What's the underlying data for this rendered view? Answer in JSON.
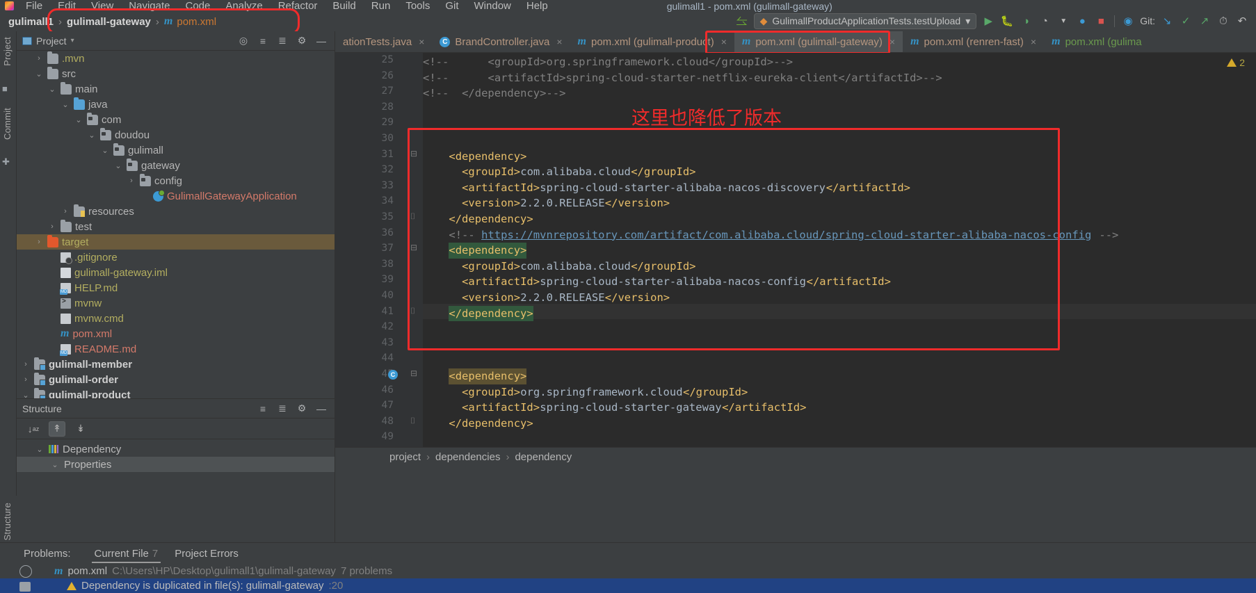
{
  "menu": {
    "items": [
      "File",
      "Edit",
      "View",
      "Navigate",
      "Code",
      "Analyze",
      "Refactor",
      "Build",
      "Run",
      "Tools",
      "Git",
      "Window",
      "Help"
    ],
    "window_title": "gulimall1 - pom.xml (gulimall-gateway)"
  },
  "navbar": {
    "crumbs": [
      "gulimall1",
      "gulimall-gateway",
      "pom.xml"
    ],
    "separator": "›"
  },
  "toolbar": {
    "run_config": "GulimallProductApplicationTests.testUpload",
    "dropdown_caret": "▾",
    "git_label": "Git:",
    "icons": {
      "back_arrow": "↖",
      "run": "▶",
      "debug": "🐞",
      "run_coverage": "◑",
      "profiler": "◔",
      "stop": "■",
      "search_everywhere": "🔍",
      "update_project": "↙",
      "commit": "✓",
      "push": "↗",
      "history": "◷",
      "undo": "↶"
    }
  },
  "left_strip": {
    "top_label": "Project",
    "commit_label": "Commit",
    "bottom_label": "Structure"
  },
  "project_panel": {
    "title": "Project",
    "title_caret": "▾",
    "buttons": [
      "locate-icon",
      "expand-all-icon",
      "collapse-all-icon",
      "gear-icon",
      "hide-icon"
    ],
    "tree": [
      {
        "indent": 1,
        "arrow": "›",
        "icon": "folder",
        "label": ".mvn",
        "style": "yellow"
      },
      {
        "indent": 1,
        "arrow": "⌄",
        "icon": "folder",
        "label": "src",
        "style": "gray"
      },
      {
        "indent": 2,
        "arrow": "⌄",
        "icon": "folder",
        "label": "main",
        "style": "gray"
      },
      {
        "indent": 3,
        "arrow": "⌄",
        "icon": "folder-blue",
        "label": "java",
        "style": "gray"
      },
      {
        "indent": 4,
        "arrow": "⌄",
        "icon": "package",
        "label": "com",
        "style": "gray"
      },
      {
        "indent": 5,
        "arrow": "⌄",
        "icon": "package",
        "label": "doudou",
        "style": "gray"
      },
      {
        "indent": 6,
        "arrow": "⌄",
        "icon": "package",
        "label": "gulimall",
        "style": "gray"
      },
      {
        "indent": 7,
        "arrow": "⌄",
        "icon": "package",
        "label": "gateway",
        "style": "gray"
      },
      {
        "indent": 8,
        "arrow": "›",
        "icon": "package",
        "label": "config",
        "style": "gray"
      },
      {
        "indent": 9,
        "arrow": "",
        "icon": "spring",
        "label": "GulimallGatewayApplication",
        "style": "red"
      },
      {
        "indent": 3,
        "arrow": "›",
        "icon": "folder-resources",
        "label": "resources",
        "style": "gray"
      },
      {
        "indent": 2,
        "arrow": "›",
        "icon": "folder",
        "label": "test",
        "style": "gray"
      },
      {
        "indent": 1,
        "arrow": "›",
        "icon": "folder-orange",
        "label": "target",
        "style": "yellow",
        "selected": true
      },
      {
        "indent": 2,
        "arrow": "",
        "icon": "gitignore",
        "label": ".gitignore",
        "style": "yellow"
      },
      {
        "indent": 2,
        "arrow": "",
        "icon": "iml",
        "label": "gulimall-gateway.iml",
        "style": "yellow"
      },
      {
        "indent": 2,
        "arrow": "",
        "icon": "md",
        "label": "HELP.md",
        "style": "yellow"
      },
      {
        "indent": 2,
        "arrow": "",
        "icon": "sh",
        "label": "mvnw",
        "style": "yellow"
      },
      {
        "indent": 2,
        "arrow": "",
        "icon": "cmd",
        "label": "mvnw.cmd",
        "style": "yellow"
      },
      {
        "indent": 2,
        "arrow": "",
        "icon": "maven",
        "label": "pom.xml",
        "style": "red"
      },
      {
        "indent": 2,
        "arrow": "",
        "icon": "md",
        "label": "README.md",
        "style": "red"
      },
      {
        "indent": 0,
        "arrow": "›",
        "icon": "folder-module",
        "label": "gulimall-member",
        "style": "bold"
      },
      {
        "indent": 0,
        "arrow": "›",
        "icon": "folder-module",
        "label": "gulimall-order",
        "style": "bold"
      },
      {
        "indent": 0,
        "arrow": "⌄",
        "icon": "folder-module",
        "label": "gulimall-product",
        "style": "bold"
      }
    ]
  },
  "structure_panel": {
    "title": "Structure",
    "header_buttons": [
      "expand-all-icon",
      "collapse-all-icon",
      "gear-icon",
      "hide-icon"
    ],
    "toolbar_buttons": [
      "sort-alphabetically-icon",
      "scroll-from-source-icon",
      "scroll-to-source-icon"
    ],
    "rows": [
      {
        "arrow": "⌄",
        "icon": "dependency-bars",
        "label": "Dependency"
      },
      {
        "arrow": "⌄",
        "icon": "",
        "label": "Properties",
        "highlight": true
      }
    ]
  },
  "editor_tabs": [
    {
      "icon": "class",
      "label": "ationTests.java",
      "active": false,
      "color": "red",
      "closable": true
    },
    {
      "icon": "class",
      "label": "BrandController.java",
      "active": false,
      "color": "red",
      "closable": true
    },
    {
      "icon": "maven",
      "label": "pom.xml (gulimall-product)",
      "active": false,
      "color": "red",
      "closable": true
    },
    {
      "icon": "maven",
      "label": "pom.xml (gulimall-gateway)",
      "active": true,
      "color": "red",
      "closable": true
    },
    {
      "icon": "maven",
      "label": "pom.xml (renren-fast)",
      "active": false,
      "color": "red",
      "closable": true
    },
    {
      "icon": "maven",
      "label": "pom.xml (gulima",
      "active": false,
      "color": "green",
      "closable": false
    }
  ],
  "editor": {
    "warning_count": "2",
    "warning_icon": "warning-triangle-icon",
    "first_line_number": 25,
    "lines": [
      {
        "n": 25,
        "segments": [
          {
            "t": "<!--",
            "c": "cmt",
            "indent": 0
          },
          {
            "t": "<groupId>org.springframework.cloud</groupId>-->",
            "c": "cmt",
            "indent": 10
          }
        ]
      },
      {
        "n": 26,
        "segments": [
          {
            "t": "<!--",
            "c": "cmt",
            "indent": 0
          },
          {
            "t": "<artifactId>spring-cloud-starter-netflix-eureka-client</artifactId>-->",
            "c": "cmt",
            "indent": 10
          }
        ]
      },
      {
        "n": 27,
        "segments": [
          {
            "t": "<!--",
            "c": "cmt",
            "indent": 0
          },
          {
            "t": "</dependency>-->",
            "c": "cmt",
            "indent": 6
          }
        ]
      },
      {
        "n": 28,
        "segments": []
      },
      {
        "n": 29,
        "segments": []
      },
      {
        "n": 30,
        "segments": []
      },
      {
        "n": 31,
        "segments": [
          {
            "t": "<dependency>",
            "c": "tag",
            "indent": 4
          }
        ]
      },
      {
        "n": 32,
        "segments": [
          {
            "t": "<groupId>",
            "c": "tag",
            "indent": 6
          },
          {
            "t": "com.alibaba.cloud",
            "c": "txt"
          },
          {
            "t": "</groupId>",
            "c": "tag"
          }
        ]
      },
      {
        "n": 33,
        "segments": [
          {
            "t": "<artifactId>",
            "c": "tag",
            "indent": 6
          },
          {
            "t": "spring-cloud-starter-alibaba-nacos-discovery",
            "c": "txt"
          },
          {
            "t": "</artifactId>",
            "c": "tag"
          }
        ]
      },
      {
        "n": 34,
        "segments": [
          {
            "t": "<version>",
            "c": "tag",
            "indent": 6
          },
          {
            "t": "2.2.0.RELEASE",
            "c": "txt"
          },
          {
            "t": "</version>",
            "c": "tag"
          }
        ]
      },
      {
        "n": 35,
        "segments": [
          {
            "t": "</dependency>",
            "c": "tag",
            "indent": 4
          }
        ]
      },
      {
        "n": 36,
        "segments": [
          {
            "t": "<!-- ",
            "c": "cmt",
            "indent": 4
          },
          {
            "t": "https://mvnrepository.com/artifact/com.alibaba.cloud/spring-cloud-starter-alibaba-nacos-config",
            "c": "link"
          },
          {
            "t": " -->",
            "c": "cmt"
          }
        ]
      },
      {
        "n": 37,
        "segments": [
          {
            "t": "<dependency>",
            "c": "tag",
            "indent": 4,
            "hl": "green"
          }
        ]
      },
      {
        "n": 38,
        "segments": [
          {
            "t": "<groupId>",
            "c": "tag",
            "indent": 6
          },
          {
            "t": "com.alibaba.cloud",
            "c": "txt"
          },
          {
            "t": "</groupId>",
            "c": "tag"
          }
        ]
      },
      {
        "n": 39,
        "segments": [
          {
            "t": "<artifactId>",
            "c": "tag",
            "indent": 6
          },
          {
            "t": "spring-cloud-starter-alibaba-nacos-config",
            "c": "txt"
          },
          {
            "t": "</artifactId>",
            "c": "tag"
          }
        ]
      },
      {
        "n": 40,
        "segments": [
          {
            "t": "<version>",
            "c": "tag",
            "indent": 6
          },
          {
            "t": "2.2.0.RELEASE",
            "c": "txt"
          },
          {
            "t": "</version>",
            "c": "tag"
          }
        ]
      },
      {
        "n": 41,
        "segments": [
          {
            "t": "</dependency>",
            "c": "tag",
            "indent": 4,
            "hl": "green"
          }
        ],
        "lineHighlight": true
      },
      {
        "n": 42,
        "segments": []
      },
      {
        "n": 43,
        "segments": []
      },
      {
        "n": 44,
        "segments": []
      },
      {
        "n": 45,
        "segments": [
          {
            "t": "<dependency>",
            "c": "tag",
            "indent": 4,
            "hl": "brown"
          }
        ]
      },
      {
        "n": 46,
        "segments": [
          {
            "t": "<groupId>",
            "c": "tag",
            "indent": 6
          },
          {
            "t": "org.springframework.cloud",
            "c": "txt"
          },
          {
            "t": "</groupId>",
            "c": "tag"
          }
        ]
      },
      {
        "n": 47,
        "segments": [
          {
            "t": "<artifactId>",
            "c": "tag",
            "indent": 6
          },
          {
            "t": "spring-cloud-starter-gateway",
            "c": "txt"
          },
          {
            "t": "</artifactId>",
            "c": "tag"
          }
        ]
      },
      {
        "n": 48,
        "segments": [
          {
            "t": "</dependency>",
            "c": "tag",
            "indent": 4
          }
        ]
      },
      {
        "n": 49,
        "segments": []
      }
    ],
    "annotation": "这里也降低了版本"
  },
  "editor_breadcrumb": {
    "items": [
      "project",
      "dependencies",
      "dependency"
    ],
    "separator": "›"
  },
  "problems": {
    "label": "Problems:",
    "tabs": [
      {
        "label": "Current File",
        "count": "7",
        "active": true
      },
      {
        "label": "Project Errors",
        "count": "",
        "active": false
      }
    ],
    "file_row": {
      "icon": "maven",
      "name": "pom.xml",
      "path": "C:\\Users\\HP\\Desktop\\gulimall1\\gulimall-gateway",
      "count": "7 problems"
    },
    "issue_row": {
      "icon": "warning-triangle-icon",
      "text": "Dependency is duplicated in file(s): gulimall-gateway",
      "location": ":20"
    }
  },
  "colors": {
    "annotation_red": "#f02b2b",
    "editor_bg": "#2b2b2b",
    "panel_bg": "#3c3f41",
    "tag": "#e8bf6a",
    "text": "#a9b7c6",
    "comment": "#808080",
    "link": "#6897bb",
    "selection_blue": "#214283",
    "selected_row": "#6a5a3c"
  }
}
